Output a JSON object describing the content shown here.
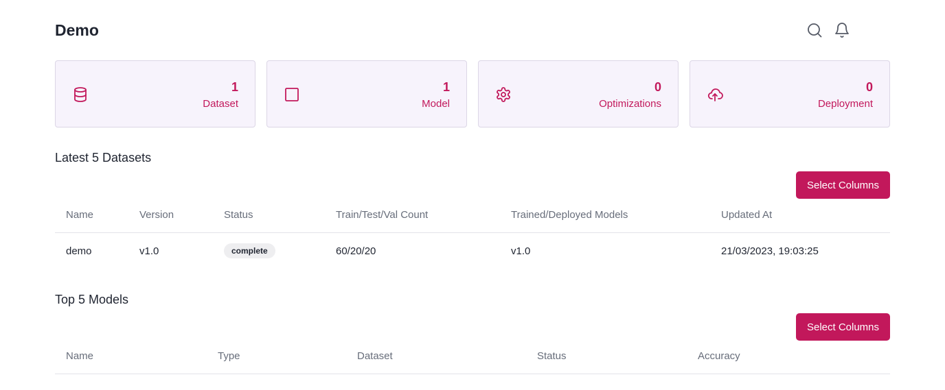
{
  "header": {
    "title": "Demo",
    "icons": [
      "search-icon",
      "bell-icon"
    ]
  },
  "stats": [
    {
      "icon": "database-icon",
      "value": "1",
      "label": "Dataset"
    },
    {
      "icon": "square-icon",
      "value": "1",
      "label": "Model"
    },
    {
      "icon": "gear-icon",
      "value": "0",
      "label": "Optimizations"
    },
    {
      "icon": "cloud-upload-icon",
      "value": "0",
      "label": "Deployment"
    }
  ],
  "datasets": {
    "title": "Latest 5 Datasets",
    "select_columns_label": "Select Columns",
    "columns": [
      "Name",
      "Version",
      "Status",
      "Train/Test/Val Count",
      "Trained/Deployed Models",
      "Updated At"
    ],
    "rows": [
      {
        "name": "demo",
        "version": "v1.0",
        "status": "complete",
        "count": "60/20/20",
        "models": "v1.0",
        "updated": "21/03/2023, 19:03:25"
      }
    ]
  },
  "models": {
    "title": "Top 5 Models",
    "select_columns_label": "Select Columns",
    "columns": [
      "Name",
      "Type",
      "Dataset",
      "Status",
      "Accuracy"
    ]
  },
  "colors": {
    "accent": "#c2185b",
    "card_background": "#f7f3fc"
  }
}
